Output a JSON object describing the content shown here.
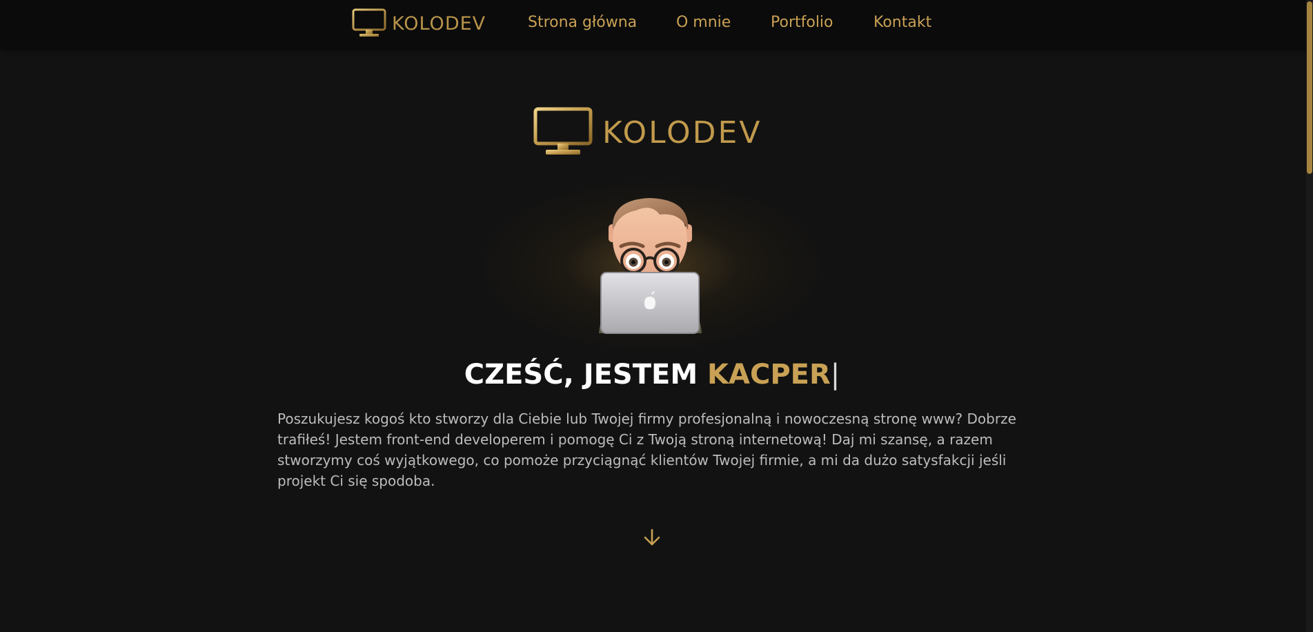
{
  "nav": {
    "logo_text": "KOLODEV",
    "links": [
      "Strona główna",
      "O mnie",
      "Portfolio",
      "Kontakt"
    ]
  },
  "hero": {
    "logo_text": "KOLODEV",
    "heading_prefix": "CZEŚĆ, JESTEM ",
    "heading_name": "KACPER",
    "cursor": "|",
    "description": "Poszukujesz kogoś kto stworzy dla Ciebie lub Twojej firmy profesjonalną i nowoczesną stronę www? Dobrze trafiłeś! Jestem front-end developerem i pomogę Ci z Twoją stroną internetową! Daj mi szansę, a razem stworzymy coś wyjątkowego, co pomoże przyciągnąć klientów Twojej firmie, a mi da dużo satysfakcji jeśli projekt Ci się spodoba."
  },
  "icons": {
    "logo": "monitor-icon",
    "scroll": "arrow-down-icon",
    "avatar": "memoji-avatar-with-laptop"
  },
  "colors": {
    "accent": "#c9a155",
    "background": "#121212",
    "navbar": "#0b0b0b",
    "text": "#bdbdbd"
  }
}
